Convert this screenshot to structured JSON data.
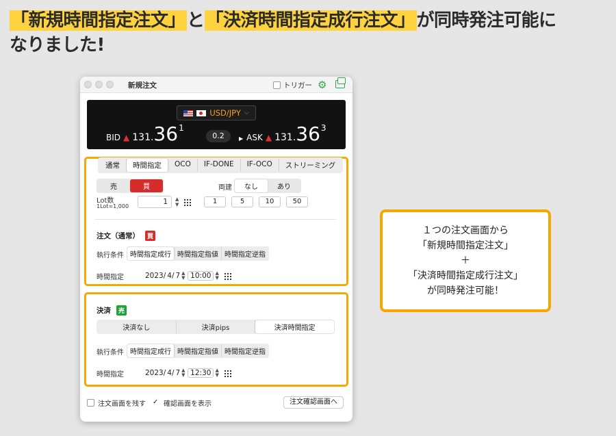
{
  "headline": {
    "line1_part1": "「新規時間指定注文」",
    "line1_part2": "と",
    "line1_part3": "「決済時間指定成行注文」",
    "line1_part4": "が同時発注可能に",
    "line2": "なりました!"
  },
  "window": {
    "title": "新規注文",
    "trigger_label": "トリガー",
    "trigger_checked": false,
    "accent_color": "#2aa84a"
  },
  "price": {
    "pair": "USD/JPY",
    "bid_label": "BID",
    "bid_prefix": "131.",
    "bid_big": "36",
    "bid_sup": "1",
    "spread": "0.2",
    "ask_label": "ASK",
    "ask_prefix": "131.",
    "ask_big": "36",
    "ask_sup": "3",
    "up_color": "#e0302f"
  },
  "tabs": [
    "通常",
    "時間指定",
    "OCO",
    "IF-DONE",
    "IF-OCO",
    "ストリーミング"
  ],
  "active_tab": "時間指定",
  "new_order": {
    "sell_label": "売",
    "buy_label": "買",
    "hedge_label": "両建",
    "hedge_no": "なし",
    "hedge_yes": "あり",
    "lot_label": "Lot数",
    "lot_note": "1Lot=1,000",
    "lot_value": "1",
    "quick": [
      "1",
      "5",
      "10",
      "50"
    ],
    "section_label": "注文（通常）",
    "section_badge": "買",
    "cond_label": "執行条件",
    "cond_options": [
      "時間指定成行",
      "時間指定指値",
      "時間指定逆指"
    ],
    "time_label": "時間指定",
    "year": "2023/",
    "month": "4/",
    "day": "7",
    "time": "10:00"
  },
  "settlement": {
    "section_label": "決済",
    "section_badge": "売",
    "options": [
      "決済なし",
      "決済pips",
      "決済時間指定"
    ],
    "cond_label": "執行条件",
    "cond_options": [
      "時間指定成行",
      "時間指定指値",
      "時間指定逆指"
    ],
    "time_label": "時間指定",
    "year": "2023/",
    "month": "4/",
    "day": "7",
    "time": "12:30"
  },
  "footer": {
    "keep_screen": "注文画面を残す",
    "show_confirm": "確認画面を表示",
    "confirm_button": "注文確認画面へ"
  },
  "callout": {
    "line1": "１つの注文画面から",
    "line2": "「新規時間指定注文」",
    "line3": "＋",
    "line4": "「決済時間指定成行注文」",
    "line5": "が同時発注可能！",
    "border_color": "#f5a800"
  }
}
